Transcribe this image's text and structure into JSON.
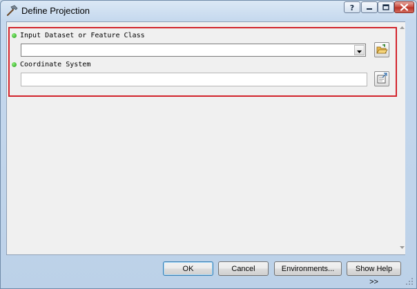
{
  "window": {
    "title": "Define Projection",
    "controls": [
      "help",
      "minimize",
      "maximize",
      "close"
    ]
  },
  "form": {
    "fields": [
      {
        "label": "Input Dataset or Feature Class",
        "value": "",
        "type": "dropdown",
        "required": true,
        "browse_icon": "open-folder-icon"
      },
      {
        "label": "Coordinate System",
        "value": "",
        "type": "text",
        "required": true,
        "browse_icon": "spatial-reference-properties-icon"
      }
    ],
    "highlight_color": "#d2222a",
    "required_indicator_color": "#1f9a16"
  },
  "buttons": {
    "ok": "OK",
    "cancel": "Cancel",
    "environments": "Environments...",
    "show_help": "Show Help >>"
  }
}
